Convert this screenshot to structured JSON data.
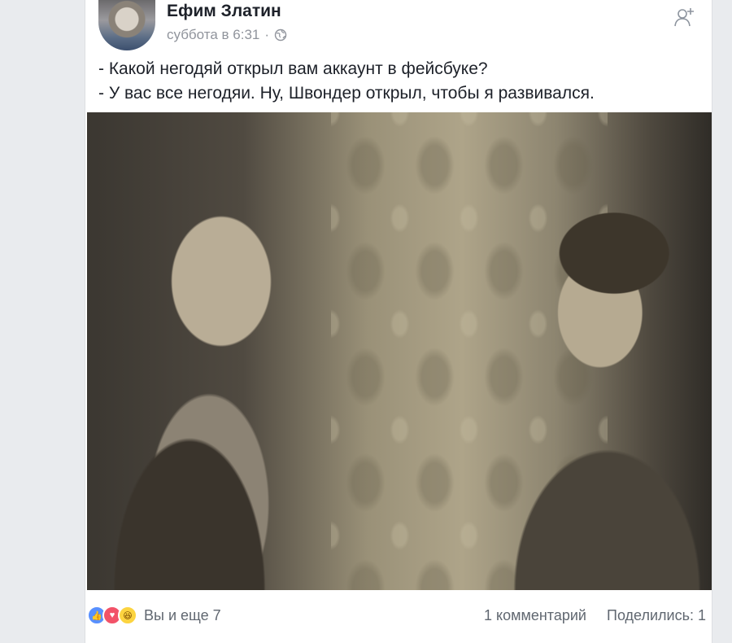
{
  "post": {
    "author_name": "Ефим Златин",
    "timestamp": "суббота в 6:31",
    "separator": "·",
    "privacy_icon": "globe-icon",
    "add_friend_icon": "add-friend-icon",
    "text_lines": [
      "- Какой негодяй открыл вам аккаунт в фейсбуке?",
      "- У вас все негодяи. Ну, Швондер открыл, чтобы я развивался."
    ]
  },
  "footer": {
    "reaction_icons": [
      "like-icon",
      "love-icon",
      "haha-icon"
    ],
    "likers_text": "Вы и еще 7",
    "comments_text": "1 комментарий",
    "shares_text": "Поделились: 1"
  },
  "colors": {
    "background": "#e9ebee",
    "name": "#1d2129",
    "secondary_text": "#90949c",
    "like_blue": "#5890ff",
    "love_red": "#f25268",
    "haha_yellow": "#fcd440"
  }
}
